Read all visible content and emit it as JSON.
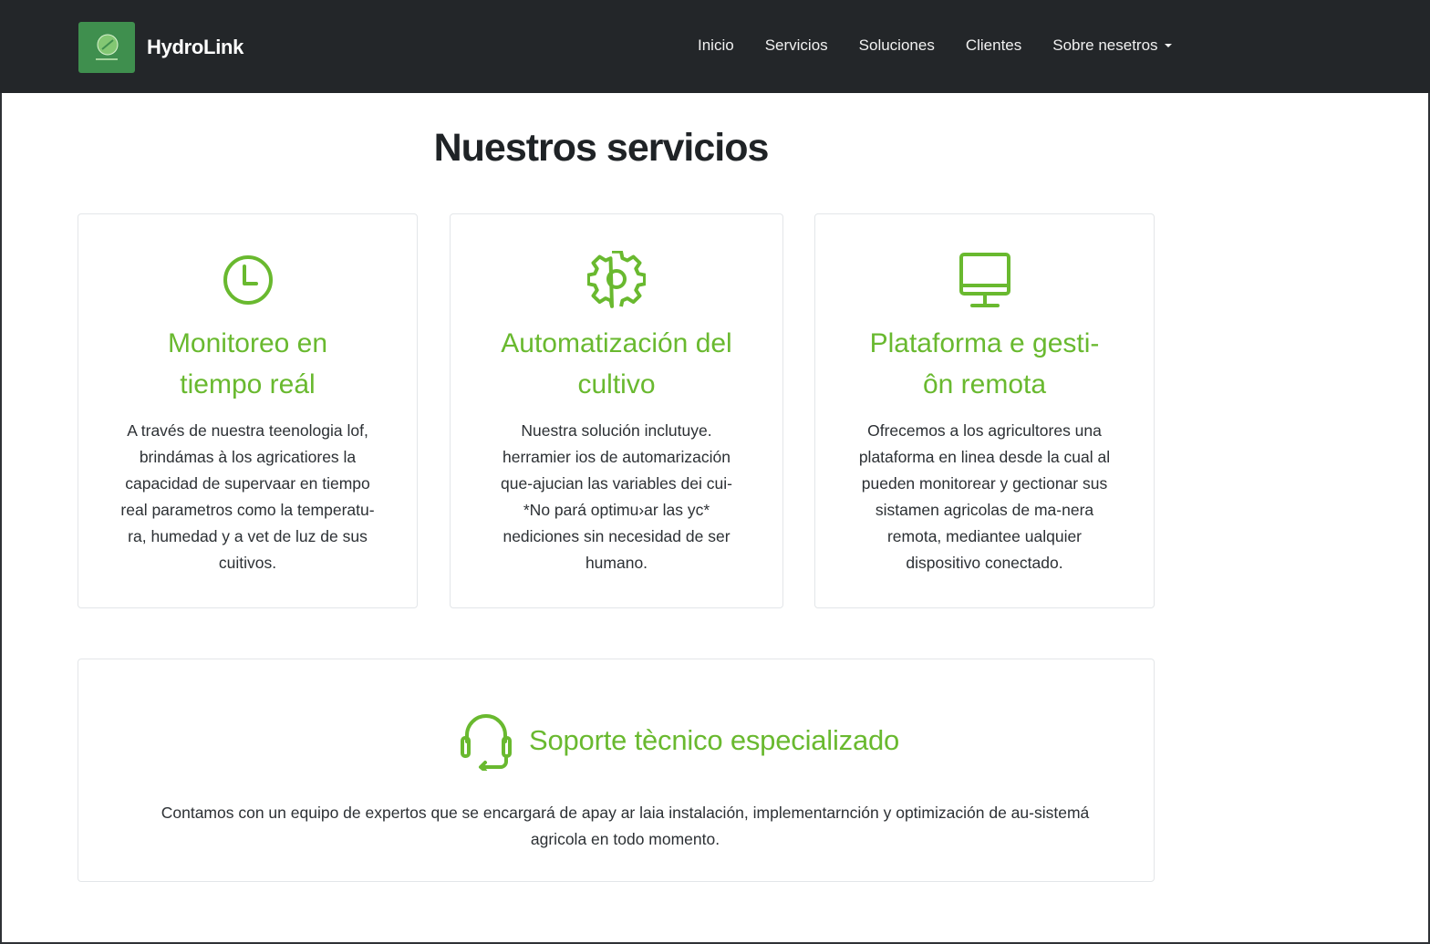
{
  "navbar": {
    "brand": "HydroLink",
    "links": [
      "Inicio",
      "Servicios",
      "Soluciones",
      "Clientes"
    ],
    "dropdown_label": "Sobre nesetros",
    "background": "#232629"
  },
  "page": {
    "title": "Nuestros servicios",
    "accent_color": "#69b92f"
  },
  "services": [
    {
      "icon": "clock-icon",
      "title_line1": "Monitoreo en",
      "title_line2": "tiempo reál",
      "text": "A través de nuestra teenologia lof, brindámas à los agricatiores la capacidad de supervaar en tiempo real parametros como la temperatu-ra, humedad y a vet de luz de sus cuitivos."
    },
    {
      "icon": "gear-icon",
      "title_line1": "Automatización del",
      "title_line2": "cultivo",
      "text": "Nuestra solución inclutuye. herramier ios de automarización que-ajucian las variables dei cui- *No pará optimu›ar las yc* nediciones sin necesidad de ser humano."
    },
    {
      "icon": "monitor-icon",
      "title_line1": "Plataforma e gesti-",
      "title_line2": "ôn remota",
      "text": "Ofrecemos a los agricultores una plataforma en linea desde la cual al pueden monitorear y gectionar sus sistamen agricolas de ma-nera remota, mediantee ualquier dispositivo conectado."
    }
  ],
  "support": {
    "icon": "headset-icon",
    "title_bold": "Soporte tècnico",
    "title_light": "especializado",
    "text": "Contamos con un equipo de expertos que se encargará de apay ar laia instalación, implementarnción y optimización de au-sistemá agricola en todo momento."
  }
}
